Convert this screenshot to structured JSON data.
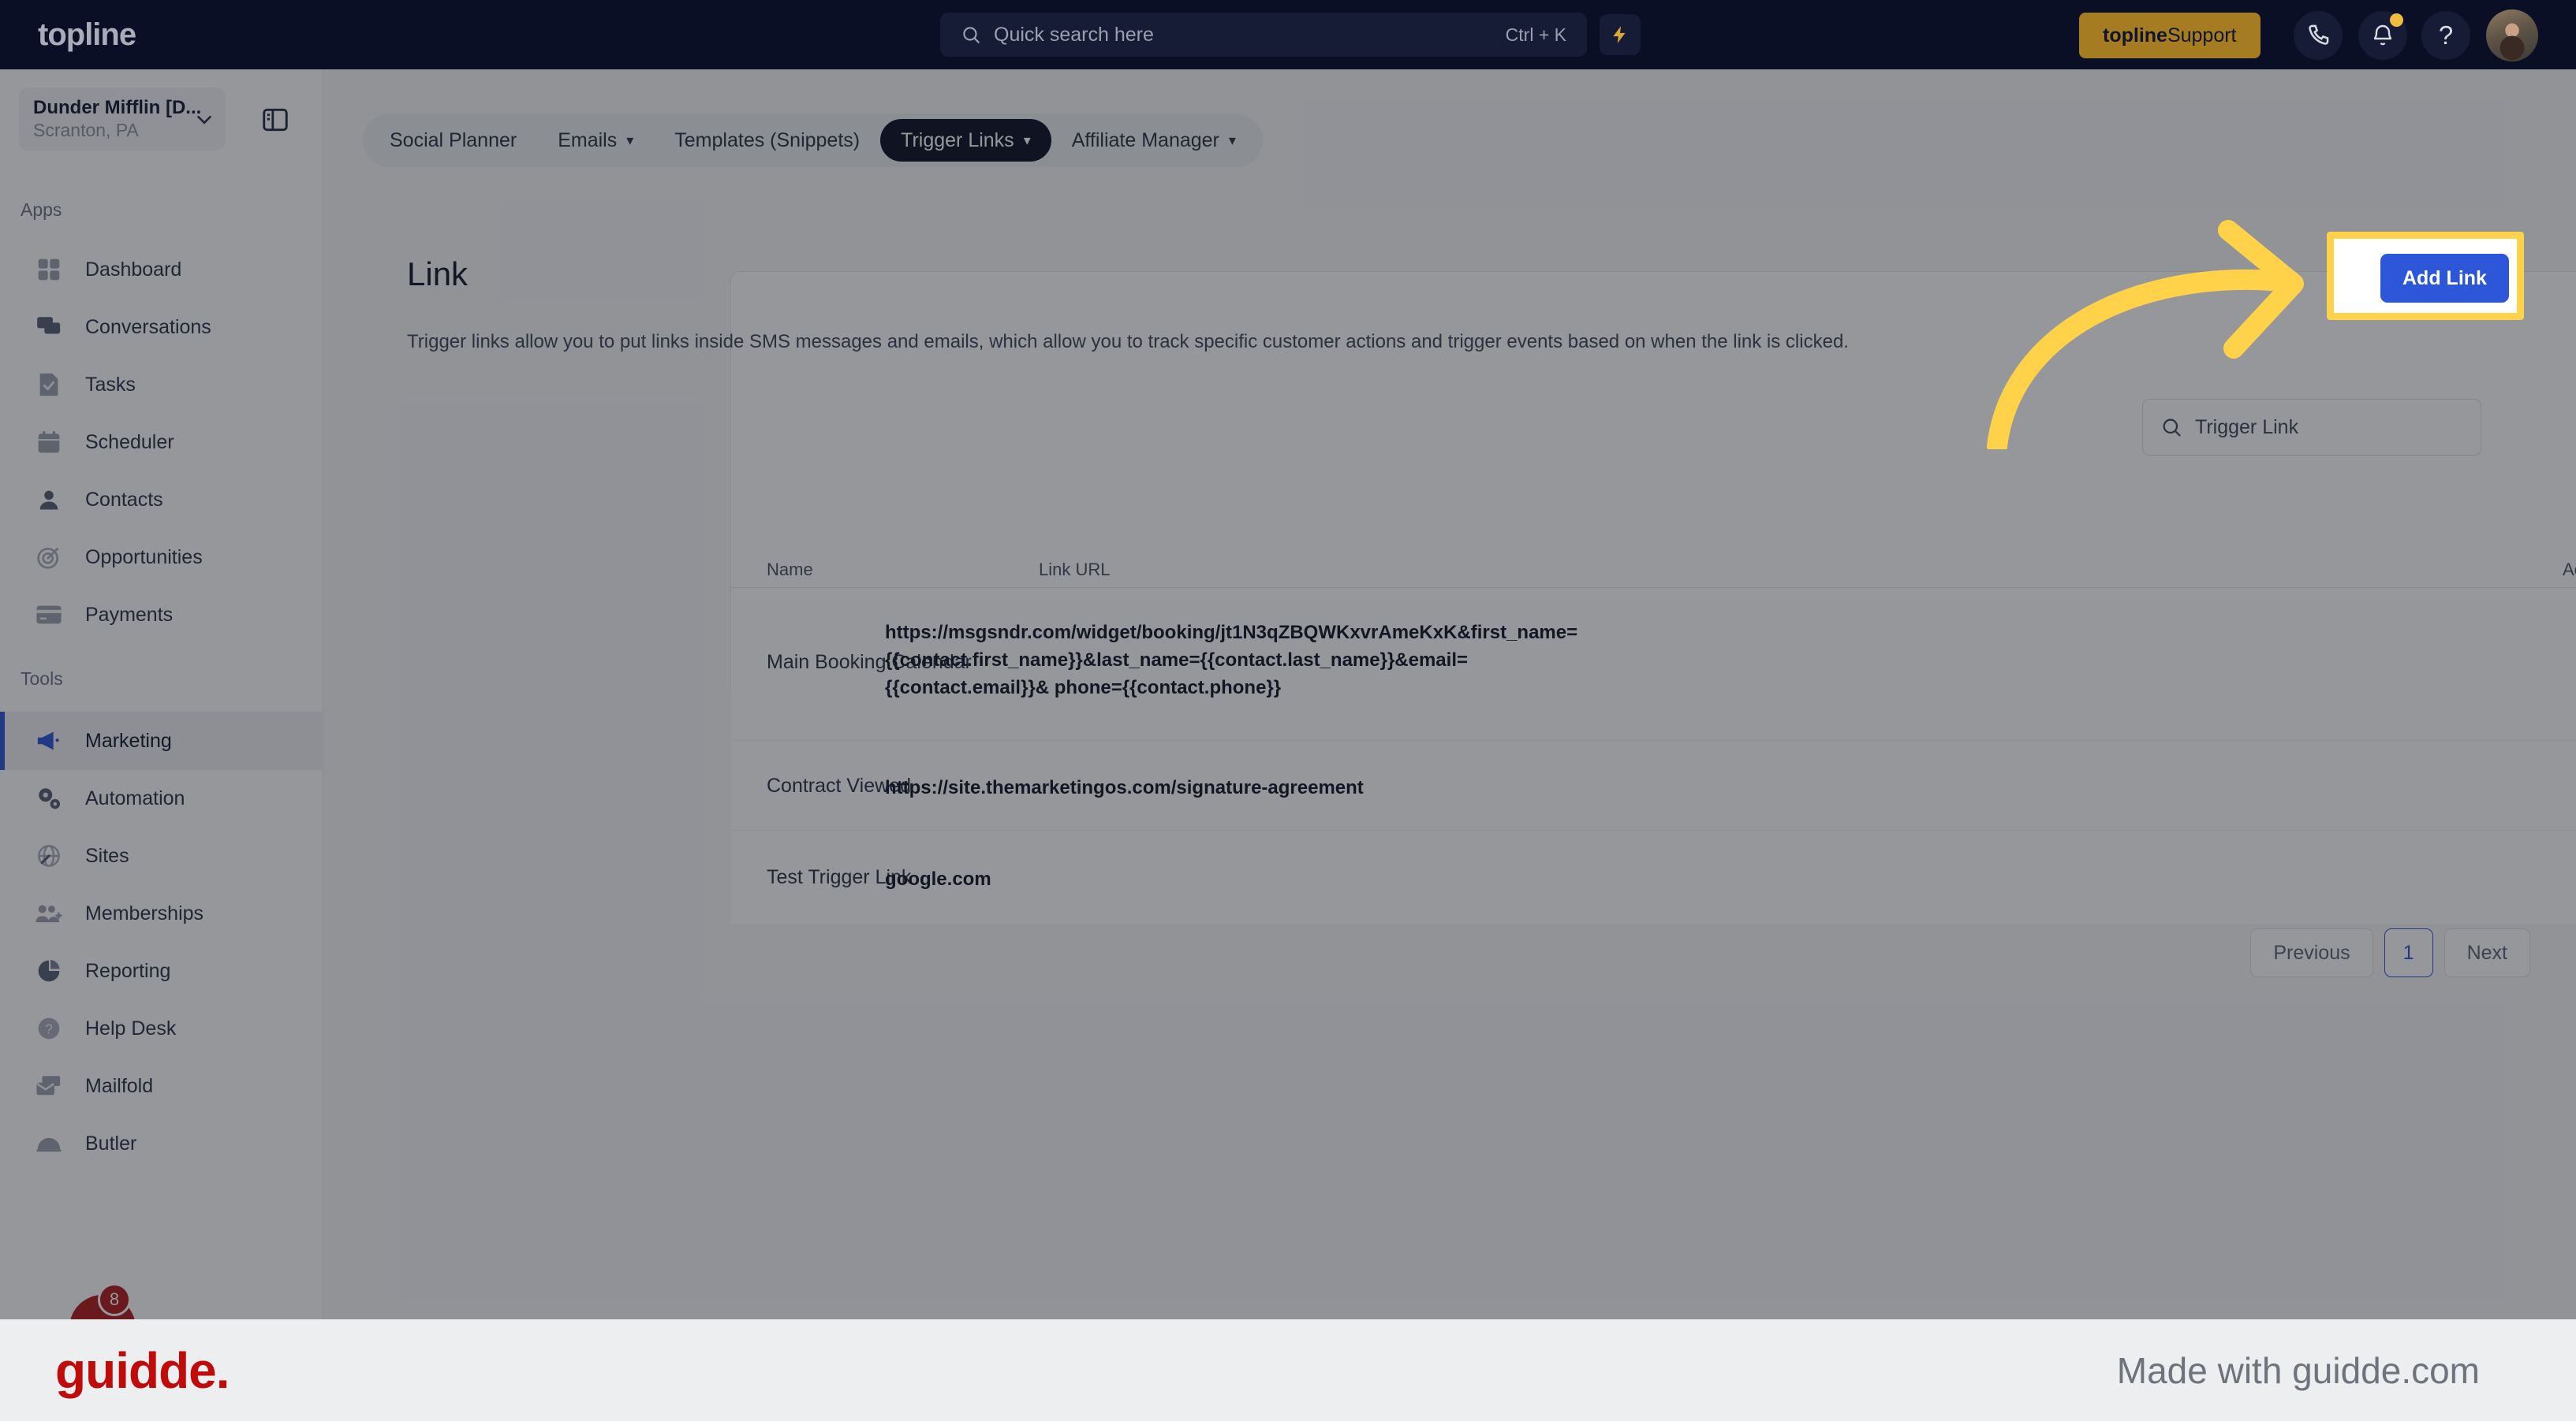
{
  "topbar": {
    "brand": "topline",
    "search": {
      "placeholder": "Quick search here",
      "shortcut": "Ctrl + K",
      "icon": "search-icon"
    },
    "bolt_icon": "lightning-bolt-icon",
    "support_button": {
      "brand": "topline",
      "label": " Support"
    },
    "phone_icon": "phone-icon",
    "bell_icon": "bell-icon",
    "help_icon": "question-mark-icon",
    "avatar": "user-avatar"
  },
  "sidebar": {
    "location": {
      "name": "Dunder Mifflin [D...",
      "sub": "Scranton, PA"
    },
    "panel_toggle_icon": "panel-toggle-icon",
    "sections": [
      {
        "label": "Apps",
        "items": [
          {
            "label": "Dashboard",
            "icon": "dashboard-icon",
            "active": false
          },
          {
            "label": "Conversations",
            "icon": "conversations-icon",
            "active": false
          },
          {
            "label": "Tasks",
            "icon": "tasks-icon",
            "active": false
          },
          {
            "label": "Scheduler",
            "icon": "calendar-icon",
            "active": false
          },
          {
            "label": "Contacts",
            "icon": "contacts-icon",
            "active": false
          },
          {
            "label": "Opportunities",
            "icon": "target-icon",
            "active": false
          },
          {
            "label": "Payments",
            "icon": "credit-card-icon",
            "active": false
          }
        ]
      },
      {
        "label": "Tools",
        "items": [
          {
            "label": "Marketing",
            "icon": "megaphone-icon",
            "active": true
          },
          {
            "label": "Automation",
            "icon": "gears-icon",
            "active": false
          },
          {
            "label": "Sites",
            "icon": "globe-icon",
            "active": false
          },
          {
            "label": "Memberships",
            "icon": "members-icon",
            "active": false
          },
          {
            "label": "Reporting",
            "icon": "pie-chart-icon",
            "active": false
          },
          {
            "label": "Help Desk",
            "icon": "help-circle-icon",
            "active": false
          },
          {
            "label": "Mailfold",
            "icon": "mail-stack-icon",
            "active": false
          },
          {
            "label": "Butler",
            "icon": "bell-desk-icon",
            "active": false
          }
        ]
      }
    ],
    "chat_badge_count": "8"
  },
  "tabs": [
    {
      "label": "Social Planner",
      "caret": false,
      "active": false
    },
    {
      "label": "Emails",
      "caret": true,
      "active": false
    },
    {
      "label": "Templates (Snippets)",
      "caret": false,
      "active": false
    },
    {
      "label": "Trigger Links",
      "caret": true,
      "active": true
    },
    {
      "label": "Affiliate Manager",
      "caret": true,
      "active": false
    }
  ],
  "page": {
    "title": "Link",
    "description": "Trigger links allow you to put links inside SMS messages and emails, which allow you to track specific customer actions and trigger events based on when the link is clicked.",
    "add_button": "Add Link",
    "trigger_search_placeholder": "Trigger Link",
    "search_icon": "search-icon"
  },
  "table": {
    "columns": [
      "Name",
      "Link URL",
      "Actions"
    ],
    "rows": [
      {
        "name": "Main Booking Calendar",
        "url": "https://msgsndr.com/widget/booking/jt1N3qZBQWKxvrAmeKxK&first_name={{contact.first_name}}&last_name={{contact.last_name}}&email={{contact.email}}& phone={{contact.phone}}",
        "edit_icon": "pencil-icon",
        "delete_icon": "trash-icon"
      },
      {
        "name": "Contract Viewed",
        "url": "https://site.themarketingos.com/signature-agreement",
        "edit_icon": "pencil-icon",
        "delete_icon": "trash-icon"
      },
      {
        "name": "Test Trigger Link",
        "url": "google.com",
        "edit_icon": "pencil-icon",
        "delete_icon": "trash-icon"
      }
    ]
  },
  "pagination": {
    "previous": "Previous",
    "page": "1",
    "next": "Next"
  },
  "footer": {
    "logo": "guidde.",
    "made_with": "Made with guidde.com"
  },
  "colors": {
    "topbar_bg": "#0b0f25",
    "accent_blue": "#2d56d8",
    "highlight_yellow": "#ffd24a",
    "support_gold": "#a57c21",
    "guidde_red": "#c00b0b"
  }
}
